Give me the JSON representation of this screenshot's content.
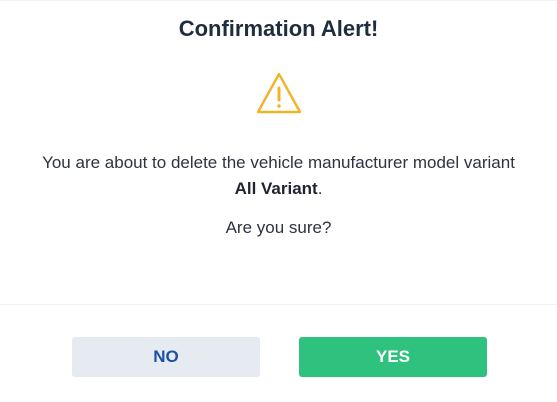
{
  "dialog": {
    "title": "Confirmation Alert!",
    "icon": "warning-triangle-icon",
    "message_prefix": "You are about to delete the vehicle manufacturer model variant",
    "item_name": "All Variant",
    "item_suffix": ".",
    "question": "Are you sure?",
    "no_label": "NO",
    "yes_label": "YES"
  },
  "colors": {
    "warning": "#f0b429",
    "yes_bg": "#2ec27e",
    "no_bg": "#e6ebf1",
    "no_text": "#1d4fa8",
    "title": "#1f2d3d"
  }
}
